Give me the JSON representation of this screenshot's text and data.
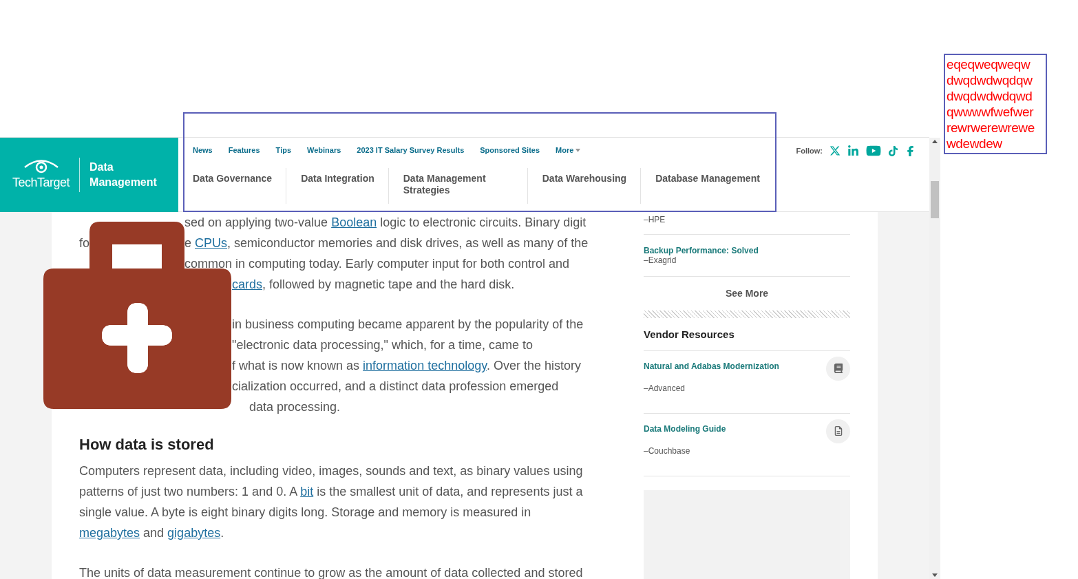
{
  "annotation_note": {
    "lines": [
      "eqeqweqweqw",
      "dwqdwdwqdqw",
      "dwqdwdwdqwd",
      "qwwwwfwefwer",
      "rewrwerewrewe",
      "wdewdew"
    ]
  },
  "logo": {
    "brand": "TechTarget",
    "section": "Data Management"
  },
  "nav": {
    "links": [
      {
        "label": "News"
      },
      {
        "label": "Features"
      },
      {
        "label": "Tips"
      },
      {
        "label": "Webinars"
      },
      {
        "label": "2023 IT Salary Survey Results"
      },
      {
        "label": "Sponsored Sites"
      }
    ],
    "more": "More",
    "categories": [
      "Data Governance",
      "Data Integration",
      "Data Management Strategies",
      "Data Warehousing",
      "Database Management"
    ],
    "follow_label": "Follow:"
  },
  "article": {
    "paragraphs": [
      {
        "lines": [
          {
            "kind": "handle",
            "segments": [
              {
                "text": "sed on applying two-value ",
                "link": false
              },
              {
                "text": "Boolean",
                "link": true
              },
              {
                "text": " logic to electronic circuits. Binary digit",
                "link": false
              }
            ]
          },
          {
            "kind": "handle",
            "left": "fo",
            "segments": [
              {
                "text": "e ",
                "link": false
              },
              {
                "text": "CPUs",
                "link": true
              },
              {
                "text": ", semiconductor memories and disk drives, as well as many of the",
                "link": false
              }
            ]
          },
          {
            "kind": "handle",
            "segments": [
              {
                "text": "common in computing today. Early computer input for both control and",
                "link": false
              }
            ]
          },
          {
            "kind": "body",
            "segments": [
              {
                "text": "cards",
                "link": true
              },
              {
                "text": ", followed by magnetic tape and the hard disk.",
                "link": false
              }
            ]
          }
        ]
      },
      {
        "lines": [
          {
            "kind": "body",
            "segments": [
              {
                "text": "in business computing became apparent by the popularity of the",
                "link": false
              }
            ]
          },
          {
            "kind": "body",
            "segments": [
              {
                "text": "\"electronic data processing,\" which, for a time, came to",
                "link": false
              }
            ]
          },
          {
            "kind": "body",
            "segments": [
              {
                "text": "f what is now known as ",
                "link": false
              },
              {
                "text": "information technology",
                "link": true
              },
              {
                "text": ".  Over the history",
                "link": false
              }
            ]
          },
          {
            "kind": "body",
            "segments": [
              {
                "text": "cialization occurred, and a distinct data profession emerged",
                "link": false
              }
            ]
          },
          {
            "kind": "tail",
            "segments": [
              {
                "text": "data processing.",
                "link": false
              }
            ]
          }
        ]
      }
    ],
    "heading": "How data is stored",
    "body": [
      [
        {
          "text": "Computers represent data, including video, images, sounds and text, as binary values using patterns of just two numbers: 1 and 0. A ",
          "link": false
        },
        {
          "text": "bit",
          "link": true
        },
        {
          "text": " is the smallest unit of data, and represents just a single value. A byte is eight binary digits long. Storage and memory is measured in ",
          "link": false
        },
        {
          "text": "megabytes",
          "link": true
        },
        {
          "text": " and ",
          "link": false
        },
        {
          "text": "gigabytes",
          "link": true
        },
        {
          "text": ".",
          "link": false
        }
      ],
      [
        {
          "text": "The units of data measurement continue to grow as the amount of data collected and stored",
          "link": false
        }
      ]
    ]
  },
  "sidebar": {
    "sponsored": [
      {
        "source": "–HPE"
      },
      {
        "title": "Backup Performance: Solved",
        "source": "–Exagrid"
      }
    ],
    "see_more": "See More",
    "vendor_title": "Vendor Resources",
    "vendor": [
      {
        "title": "Natural and Adabas Modernization",
        "source": "–Advanced",
        "kind": "book"
      },
      {
        "title": "Data Modeling Guide",
        "source": "–Couchbase",
        "kind": "document"
      }
    ]
  }
}
